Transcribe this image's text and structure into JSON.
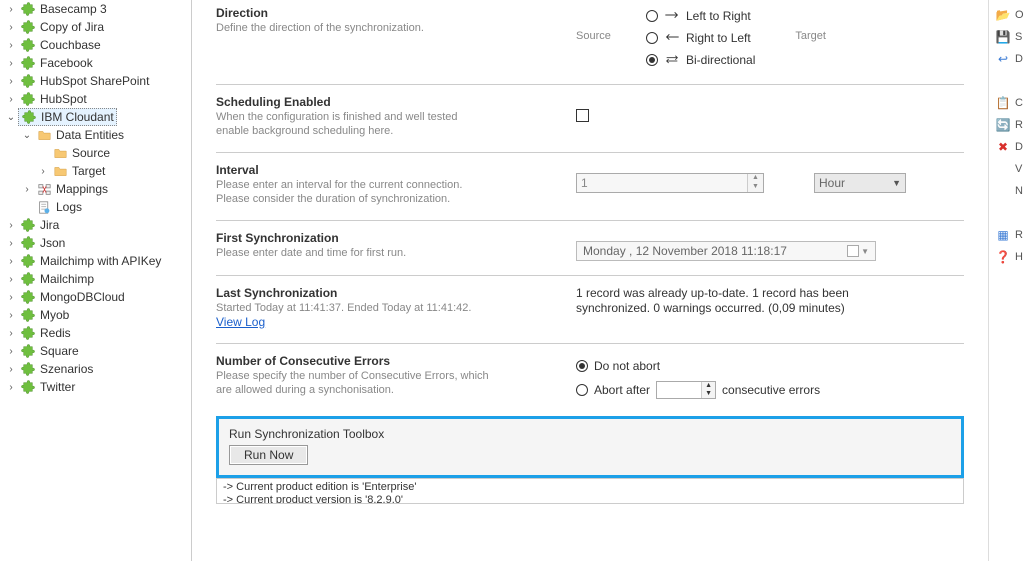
{
  "tree": {
    "items": [
      {
        "label": "Basecamp 3",
        "icon": "puzzle",
        "caret": ">",
        "indent": 0
      },
      {
        "label": "Copy of Jira",
        "icon": "puzzle",
        "caret": ">",
        "indent": 0
      },
      {
        "label": "Couchbase",
        "icon": "puzzle",
        "caret": ">",
        "indent": 0
      },
      {
        "label": "Facebook",
        "icon": "puzzle",
        "caret": ">",
        "indent": 0
      },
      {
        "label": "HubSpot SharePoint",
        "icon": "puzzle",
        "caret": ">",
        "indent": 0
      },
      {
        "label": "HubSpot",
        "icon": "puzzle",
        "caret": ">",
        "indent": 0
      },
      {
        "label": "IBM Cloudant",
        "icon": "puzzle",
        "caret": "v",
        "indent": 0,
        "selected": true
      },
      {
        "label": "Data Entities",
        "icon": "folder",
        "caret": "v",
        "indent": 1
      },
      {
        "label": "Source",
        "icon": "folder",
        "caret": "",
        "indent": 2
      },
      {
        "label": "Target",
        "icon": "folder",
        "caret": ">",
        "indent": 2
      },
      {
        "label": "Mappings",
        "icon": "mappings",
        "caret": ">",
        "indent": 1
      },
      {
        "label": "Logs",
        "icon": "logs",
        "caret": "",
        "indent": 1
      },
      {
        "label": "Jira",
        "icon": "puzzle",
        "caret": ">",
        "indent": 0
      },
      {
        "label": "Json",
        "icon": "puzzle",
        "caret": ">",
        "indent": 0
      },
      {
        "label": "Mailchimp with APIKey",
        "icon": "puzzle",
        "caret": ">",
        "indent": 0
      },
      {
        "label": "Mailchimp",
        "icon": "puzzle",
        "caret": ">",
        "indent": 0
      },
      {
        "label": "MongoDBCloud",
        "icon": "puzzle",
        "caret": ">",
        "indent": 0
      },
      {
        "label": "Myob",
        "icon": "puzzle",
        "caret": ">",
        "indent": 0
      },
      {
        "label": "Redis",
        "icon": "puzzle",
        "caret": ">",
        "indent": 0
      },
      {
        "label": "Square",
        "icon": "puzzle",
        "caret": ">",
        "indent": 0
      },
      {
        "label": "Szenarios",
        "icon": "puzzle",
        "caret": ">",
        "indent": 0
      },
      {
        "label": "Twitter",
        "icon": "puzzle",
        "caret": ">",
        "indent": 0
      }
    ]
  },
  "direction": {
    "title": "Direction",
    "desc": "Define the direction of the synchronization.",
    "source_label": "Source",
    "target_label": "Target",
    "options": {
      "lr": "Left to Right",
      "rl": "Right to Left",
      "bi": "Bi-directional"
    },
    "selected": "bi"
  },
  "scheduling": {
    "title": "Scheduling Enabled",
    "desc1": "When the configuration is finished and well tested",
    "desc2": "enable background scheduling here.",
    "checked": false
  },
  "interval": {
    "title": "Interval",
    "desc1": "Please enter an interval for the current connection.",
    "desc2": "Please consider the duration of synchronization.",
    "value": "1",
    "unit": "Hour"
  },
  "firstsync": {
    "title": "First Synchronization",
    "desc": "Please enter date and time for first run.",
    "value": "Monday  , 12 November 2018 11:18:17"
  },
  "lastsync": {
    "title": "Last Synchronization",
    "desc": "Started  Today at 11:41:37. Ended Today at 11:41:42.",
    "link": "View Log",
    "status": "1 record was already up-to-date. 1 record has been synchronized. 0 warnings occurred. (0,09 minutes)"
  },
  "errors": {
    "title": "Number of Consecutive Errors",
    "desc1": "Please specify the number of Consecutive Errors, which",
    "desc2": "are allowed during a synchonisation.",
    "opt_noabort": "Do not abort",
    "opt_abort_prefix": "Abort after",
    "opt_abort_suffix": "consecutive errors",
    "selected": "noabort",
    "value": ""
  },
  "toolbox": {
    "title": "Run Synchronization Toolbox",
    "run_label": "Run Now"
  },
  "log": {
    "line1": "-> Current product edition is 'Enterprise'",
    "line2": "-> Current product version is '8.2.9.0'"
  },
  "rightbar": {
    "items": [
      {
        "glyph": "📂",
        "txt": "O",
        "name": "open-icon"
      },
      {
        "glyph": "💾",
        "txt": "S",
        "name": "save-icon"
      },
      {
        "glyph": "↩",
        "txt": "D",
        "name": "undo-icon",
        "color": "#3a7bd5"
      },
      {
        "glyph": "",
        "txt": "",
        "name": "spacer"
      },
      {
        "glyph": "📋",
        "txt": "C",
        "name": "copy-icon"
      },
      {
        "glyph": "🔄",
        "txt": "R",
        "name": "refresh-icon",
        "color": "#2a9d2a"
      },
      {
        "glyph": "✖",
        "txt": "D",
        "name": "delete-icon",
        "color": "#d9302c"
      },
      {
        "glyph": "",
        "txt": "V",
        "name": "view-icon"
      },
      {
        "glyph": "",
        "txt": "N",
        "name": "new-icon"
      },
      {
        "glyph": "",
        "txt": "",
        "name": "spacer2"
      },
      {
        "glyph": "▦",
        "txt": "R",
        "name": "report-icon",
        "color": "#3a7bd5"
      },
      {
        "glyph": "❓",
        "txt": "H",
        "name": "help-icon",
        "color": "#3a7bd5"
      }
    ]
  }
}
